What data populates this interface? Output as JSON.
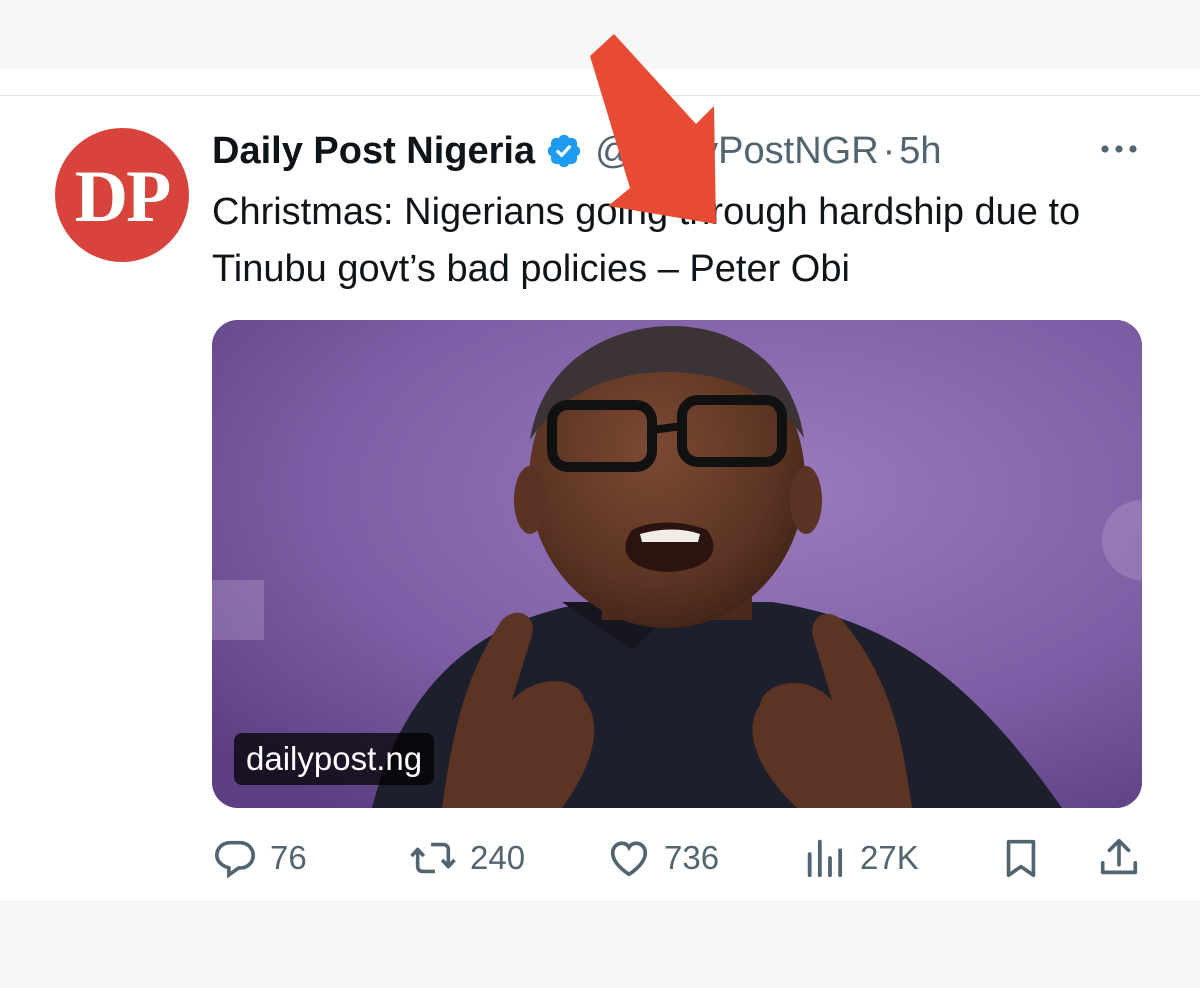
{
  "tweet": {
    "display_name": "Daily Post Nigeria",
    "handle": "@DailyPostNGR",
    "separator": "·",
    "time": "5h",
    "avatar_text": "DP",
    "text": "Christmas: Nigerians going through hardship due to Tinubu govt’s bad policies – Peter Obi",
    "link_card_domain": "dailypost.ng"
  },
  "actions": {
    "replies": "76",
    "reposts": "240",
    "likes": "736",
    "views": "27K"
  },
  "icons": {
    "verified": "verified-badge-icon",
    "more": "more-horizontal-icon",
    "reply": "reply-icon",
    "repost": "repost-icon",
    "like": "heart-icon",
    "views": "views-chart-icon",
    "bookmark": "bookmark-icon",
    "share": "share-icon",
    "annotation": "red-arrow-icon"
  },
  "colors": {
    "avatar_bg": "#d8443c",
    "verified": "#1d9bf0",
    "secondary_text": "#536471",
    "annotation_arrow": "#e84b33"
  }
}
